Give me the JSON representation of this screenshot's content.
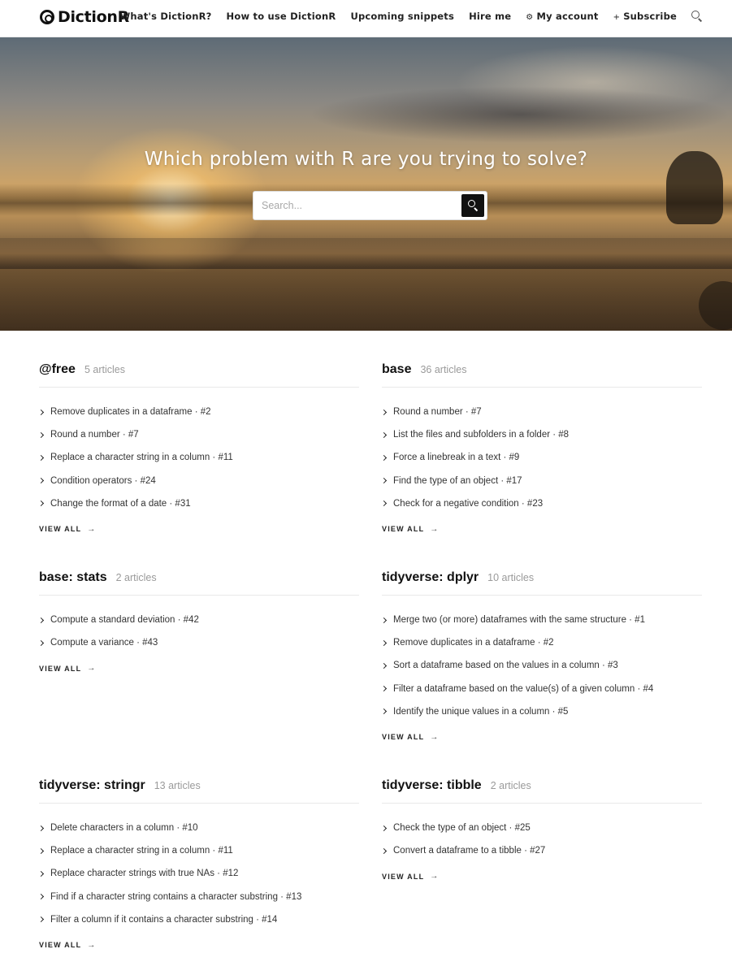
{
  "header": {
    "logo_text": "DictionR",
    "nav": [
      {
        "label": "What's DictionR?"
      },
      {
        "label": "How to use DictionR"
      },
      {
        "label": "Upcoming snippets"
      },
      {
        "label": "Hire me"
      },
      {
        "label": "My account",
        "icon": "gear-icon"
      },
      {
        "label": "Subscribe",
        "icon": "plus-icon"
      }
    ],
    "search_icon": "search-icon"
  },
  "hero": {
    "title": "Which problem with R are you trying to solve?",
    "search_placeholder": "Search..."
  },
  "categories": [
    {
      "title": "@free",
      "count": "5 articles",
      "items": [
        "Remove duplicates in a dataframe · #2",
        "Round a number · #7",
        "Replace a character string in a column · #11",
        "Condition operators · #24",
        "Change the format of a date · #31"
      ],
      "view_all": "VIEW ALL"
    },
    {
      "title": "base",
      "count": "36 articles",
      "items": [
        "Round a number · #7",
        "List the files and subfolders in a folder · #8",
        "Force a linebreak in a text · #9",
        "Find the type of an object · #17",
        "Check for a negative condition · #23"
      ],
      "view_all": "VIEW ALL"
    },
    {
      "title": "base: stats",
      "count": "2 articles",
      "items": [
        "Compute a standard deviation · #42",
        "Compute a variance · #43"
      ],
      "view_all": "VIEW ALL"
    },
    {
      "title": "tidyverse: dplyr",
      "count": "10 articles",
      "items": [
        "Merge two (or more) dataframes with the same structure · #1",
        "Remove duplicates in a dataframe · #2",
        "Sort a dataframe based on the values in a column · #3",
        "Filter a dataframe based on the value(s) of a given column · #4",
        "Identify the unique values in a column · #5"
      ],
      "view_all": "VIEW ALL"
    },
    {
      "title": "tidyverse: stringr",
      "count": "13 articles",
      "items": [
        "Delete characters in a column · #10",
        "Replace a character string in a column · #11",
        "Replace character strings with true NAs · #12",
        "Find if a character string contains a character substring · #13",
        "Filter a column if it contains a character substring · #14"
      ],
      "view_all": "VIEW ALL"
    },
    {
      "title": "tidyverse: tibble",
      "count": "2 articles",
      "items": [
        "Check the type of an object · #25",
        "Convert a dataframe to a tibble · #27"
      ],
      "view_all": "VIEW ALL"
    }
  ]
}
